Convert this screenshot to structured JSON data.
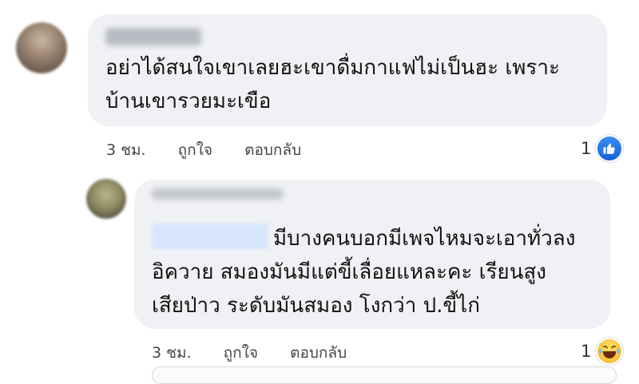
{
  "comments": [
    {
      "text_lines": [
        "อย่าได้สนใจเขาเลยฮะเขาดื่มกาแฟไม่เป็นฮะ เพราะ",
        "บ้านเขารวยมะเขือ"
      ],
      "time": "3 ชม.",
      "like_label": "ถูกใจ",
      "reply_label": "ตอบกลับ",
      "reaction_count": "1",
      "reaction_icon": "like-icon"
    },
    {
      "text_lines": [
        "มีบางคนบอกมีเพจไหมจะเอาทั่วลง",
        "อิควาย สมองมันมีแต่ขี้เลื่อยแหละคะ เรียนสูง",
        "เสียป่าว ระดับมันสมอง โงกว่า ป.ขี้ไก่"
      ],
      "time": "3 ชม.",
      "like_label": "ถูกใจ",
      "reply_label": "ตอบกลับ",
      "reaction_count": "1",
      "reaction_icon": "haha-icon"
    }
  ],
  "colors": {
    "bubble": "#eff1f4",
    "like_blue": "#1877f2",
    "haha_yellow": "#f7b125"
  }
}
